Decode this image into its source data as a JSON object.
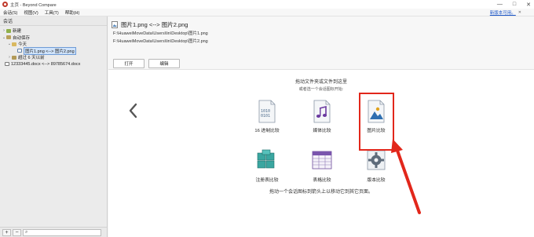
{
  "window": {
    "title": "主页 - Beyond Compare",
    "controls": [
      "—",
      "□",
      "✕"
    ]
  },
  "menu": {
    "items": [
      "会话(S)",
      "视图(V)",
      "工具(T)",
      "帮助(H)"
    ],
    "update_link": "新版本可用。",
    "update_close": "✕"
  },
  "sidebar": {
    "header": "会话",
    "tree": [
      {
        "twisty": "›",
        "label": "新建"
      },
      {
        "twisty": "⌄",
        "label": "自动保存"
      },
      {
        "twisty": "⌄",
        "label": "今天"
      },
      {
        "twisty": "",
        "label": "图片1.png <--> 图片2.png"
      },
      {
        "twisty": "›",
        "label": "超过 6 天以前"
      },
      {
        "twisty": "",
        "label": "12333445.docx <--> 89785674.docx"
      }
    ],
    "add": "+",
    "remove": "−",
    "search_icon_glyph": "⌕",
    "search_placeholder": ""
  },
  "session": {
    "title": "图片1.png <--> 图片2.png",
    "left_path": "F:\\HuaweiMoveData\\Users\\lin\\Desktop\\图片1.png",
    "right_path": "F:\\HuaweiMoveData\\Users\\lin\\Desktop\\图片2.png",
    "open_button": "打开",
    "edit_button": "编辑"
  },
  "home": {
    "hint_main": "拖动文件夹或文件到这里",
    "hint_sub": "或者选一个会话图标开始:",
    "tiles": {
      "hex": "16 进制比较",
      "media": "媒体比较",
      "picture": "图片比较",
      "registry": "注册表比较",
      "table": "表格比较",
      "version": "版本比较"
    },
    "hex_digits_1": "1010",
    "hex_digits_2": "0101",
    "footer_hint": "拖动一个会话图标到箭头上以移动它到其它页面。"
  },
  "colors": {
    "highlight": "#e2271b",
    "selection": "#cfe3fb",
    "link": "#1a55c8"
  }
}
